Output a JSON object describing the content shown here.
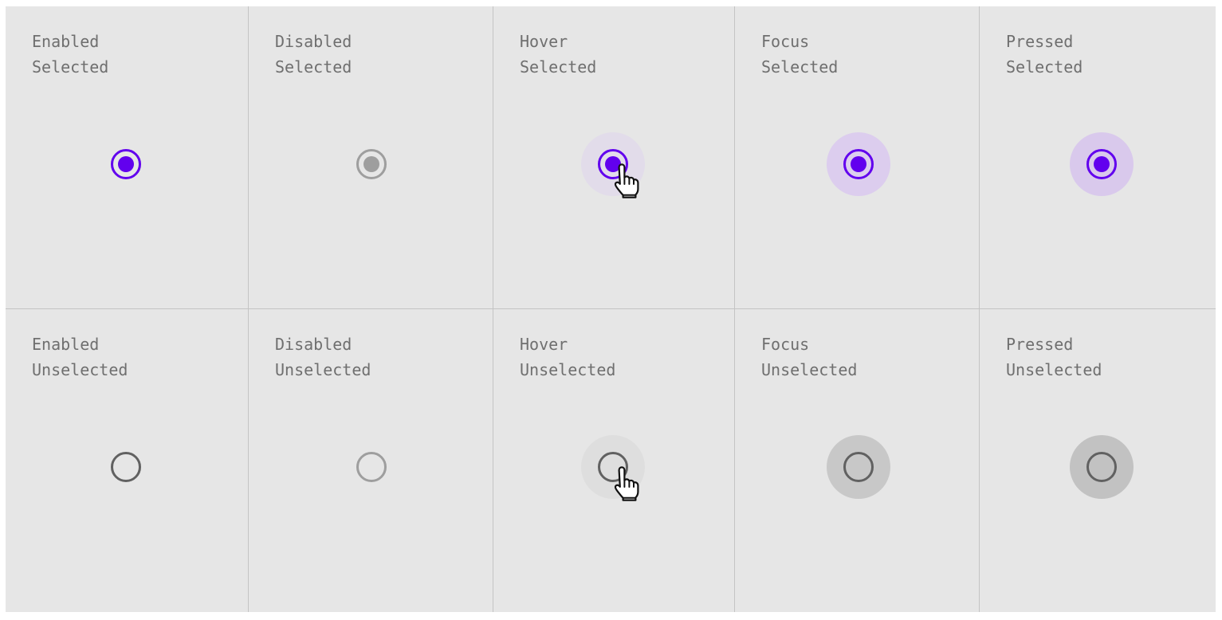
{
  "colors": {
    "board_bg": "#e6e6e6",
    "grid_line": "#c4c4c4",
    "label": "#6f6f6f",
    "primary": "#6200ee",
    "disabled": "#9e9e9e",
    "unselected": "#616161",
    "primary_halo": "#dccdee",
    "hover_neutral_halo": "#dedede",
    "pressed_neutral_halo": "#c2c2c2"
  },
  "rows": [
    {
      "row_name": "selected",
      "cells": [
        {
          "state": "Enabled",
          "selection": "Selected"
        },
        {
          "state": "Disabled",
          "selection": "Selected"
        },
        {
          "state": "Hover",
          "selection": "Selected"
        },
        {
          "state": "Focus",
          "selection": "Selected"
        },
        {
          "state": "Pressed",
          "selection": "Selected"
        }
      ]
    },
    {
      "row_name": "unselected",
      "cells": [
        {
          "state": "Enabled",
          "selection": "Unselected"
        },
        {
          "state": "Disabled",
          "selection": "Unselected"
        },
        {
          "state": "Hover",
          "selection": "Unselected"
        },
        {
          "state": "Focus",
          "selection": "Unselected"
        },
        {
          "state": "Pressed",
          "selection": "Unselected"
        }
      ]
    }
  ],
  "icons": {
    "cursor": "hand-pointer-icon"
  }
}
